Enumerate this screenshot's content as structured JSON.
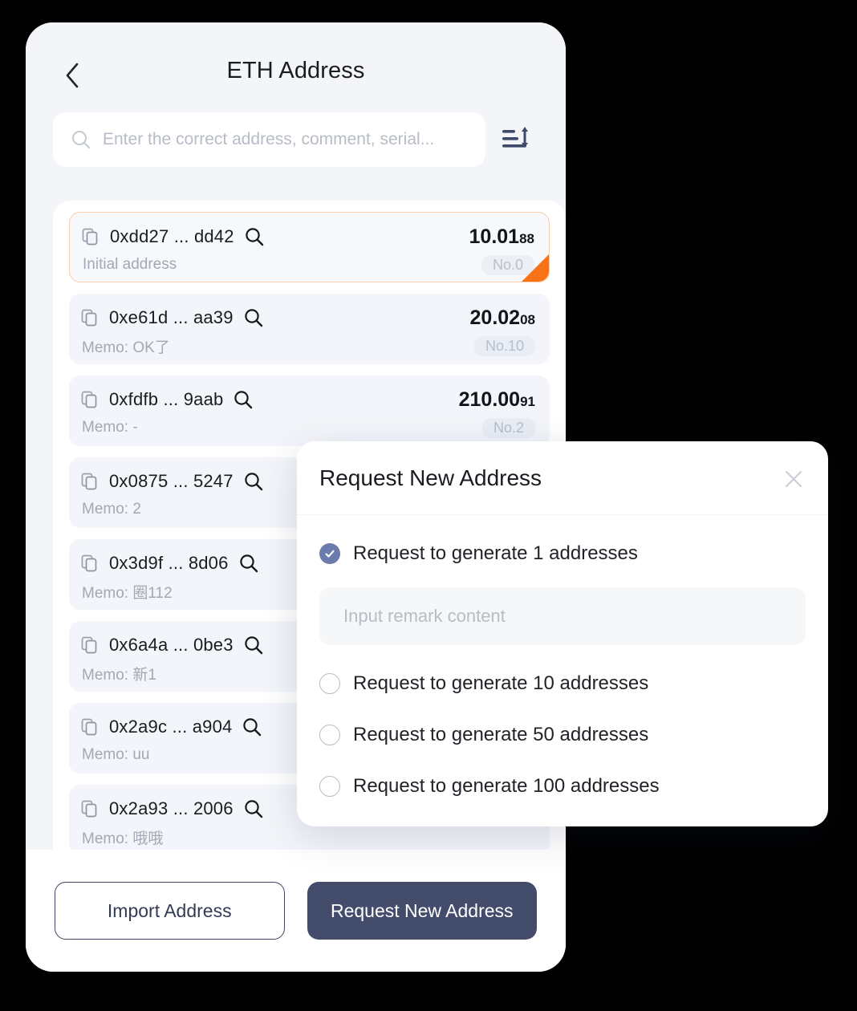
{
  "header": {
    "back_icon": "chevron-left-icon",
    "title": "ETH Address"
  },
  "search": {
    "icon": "search-icon",
    "placeholder": "Enter the correct address, comment, serial...",
    "value": "",
    "sort_icon": "sort-icon"
  },
  "address_list": [
    {
      "copy_icon": "copy-icon",
      "address": "0xdd27 ... dd42",
      "magnify_icon": "magnify-icon",
      "amount_main": "10.01",
      "amount_frac": "88",
      "memo": "Initial address",
      "serial": "No.0",
      "highlighted": true,
      "corner_color": "#f97316"
    },
    {
      "copy_icon": "copy-icon",
      "address": "0xe61d ... aa39",
      "magnify_icon": "magnify-icon",
      "amount_main": "20.02",
      "amount_frac": "08",
      "memo": "Memo: OK了",
      "serial": "No.10",
      "highlighted": false
    },
    {
      "copy_icon": "copy-icon",
      "address": "0xfdfb ... 9aab",
      "magnify_icon": "magnify-icon",
      "amount_main": "210.00",
      "amount_frac": "91",
      "memo": "Memo: -",
      "serial": "No.2",
      "highlighted": false
    },
    {
      "copy_icon": "copy-icon",
      "address": "0x0875 ... 5247",
      "magnify_icon": "magnify-icon",
      "amount_main": "",
      "amount_frac": "",
      "memo": "Memo: 2",
      "serial": "",
      "highlighted": false
    },
    {
      "copy_icon": "copy-icon",
      "address": "0x3d9f ... 8d06",
      "magnify_icon": "magnify-icon",
      "amount_main": "",
      "amount_frac": "",
      "memo": "Memo: 圈112",
      "serial": "",
      "highlighted": false
    },
    {
      "copy_icon": "copy-icon",
      "address": "0x6a4a ... 0be3",
      "magnify_icon": "magnify-icon",
      "amount_main": "",
      "amount_frac": "",
      "memo": "Memo: 新1",
      "serial": "",
      "highlighted": false
    },
    {
      "copy_icon": "copy-icon",
      "address": "0x2a9c ... a904",
      "magnify_icon": "magnify-icon",
      "amount_main": "",
      "amount_frac": "",
      "memo": "Memo: uu",
      "serial": "",
      "highlighted": false
    },
    {
      "copy_icon": "copy-icon",
      "address": "0x2a93 ... 2006",
      "magnify_icon": "magnify-icon",
      "amount_main": "",
      "amount_frac": "",
      "memo": "Memo: 哦哦",
      "serial": "",
      "highlighted": false
    }
  ],
  "footer": {
    "import_label": "Import Address",
    "request_label": "Request New Address"
  },
  "modal": {
    "title": "Request New Address",
    "close_icon": "close-icon",
    "options": [
      {
        "label": "Request to generate 1 addresses",
        "checked": true
      },
      {
        "label": "Request to generate 10 addresses",
        "checked": false
      },
      {
        "label": "Request to generate 50 addresses",
        "checked": false
      },
      {
        "label": "Request to generate 100 addresses",
        "checked": false
      }
    ],
    "remark_placeholder": "Input remark content",
    "remark_value": ""
  },
  "colors": {
    "accent_orange": "#f97316",
    "primary_navy": "#434d6b",
    "radio_checked": "#6b7bab",
    "panel_bg": "#f4f5f9",
    "card_bg": "#f3f5fa"
  }
}
